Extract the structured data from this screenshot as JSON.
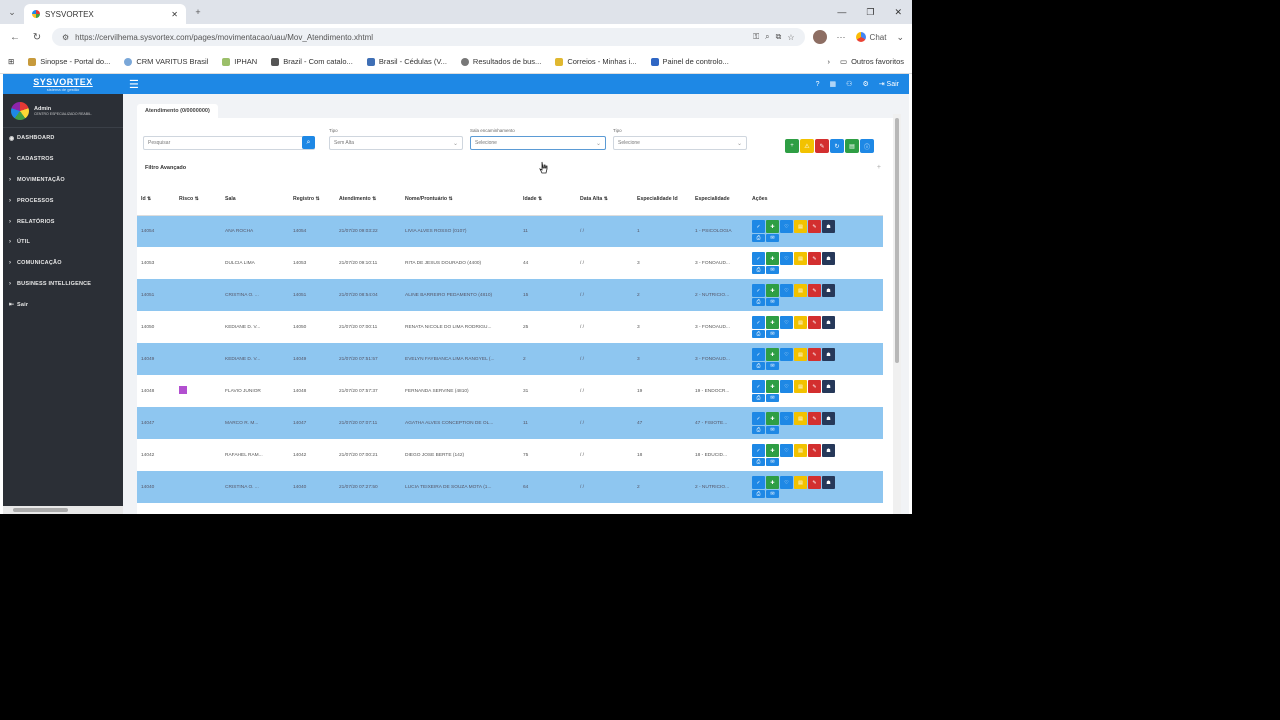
{
  "browser": {
    "tab_title": "SYSVORTEX",
    "new_tab": "+",
    "url": "https://cervilhema.sysvortex.com/pages/movimentacao/uau/Mov_Atendimento.xhtml",
    "chat_label": "Chat",
    "bookmarks": [
      "Sinopse - Portal do...",
      "CRM VARITUS Brasil",
      "IPHAN",
      "Brazil - Com catalo...",
      "Brasil - Cédulas (V...",
      "Resultados de bus...",
      "Correios - Minhas i...",
      "Painel de controlo..."
    ],
    "other_bookmarks": "Outros favoritos"
  },
  "app": {
    "logo": "SYSVORTEX",
    "logo_sub": "sistema de gestão",
    "user_name": "Admin",
    "user_org": "CENTRO ESPECIALIZADO REABIL.",
    "logout": "Sair",
    "menu": [
      {
        "icon": "◉",
        "label": "DASHBOARD"
      },
      {
        "icon": "›",
        "label": "CADASTROS"
      },
      {
        "icon": "›",
        "label": "MOVIMENTAÇÃO"
      },
      {
        "icon": "›",
        "label": "PROCESSOS"
      },
      {
        "icon": "›",
        "label": "RELATÓRIOS"
      },
      {
        "icon": "›",
        "label": "ÚTIL"
      },
      {
        "icon": "›",
        "label": "COMUNICAÇÃO"
      },
      {
        "icon": "›",
        "label": "BUSINESS INTELLIGENCE"
      },
      {
        "icon": "⇤",
        "label": "Sair"
      }
    ]
  },
  "page": {
    "tab_title": "Atendimento (0/0000000)",
    "search_placeholder": "Pesquisar",
    "filter_tipo_label": "Tipo",
    "filter_tipo_value": "Sem Alta",
    "filter_sala_label": "Sala encaminhamento",
    "filter_sala_value": "Selecione",
    "filter_tipo2_label": "Tipo",
    "filter_tipo2_value": "Selecione",
    "section_title": "Filtro Avançado",
    "section_plus": "+"
  },
  "table": {
    "headers": [
      "Id ⇅",
      "Risco ⇅",
      "Sala",
      "Registro ⇅",
      "Atendimento ⇅",
      "Nome/Prontuário ⇅",
      "Idade ⇅",
      "Data Alta ⇅",
      "Especialidade Id",
      "Especialidade",
      "Ações"
    ],
    "rows": [
      {
        "id": "14054",
        "risk": false,
        "sala": "ANA ROCHA",
        "reg": "14054",
        "at": "21/07/20 09:03:22",
        "nome": "LIVIA ALVES ROSSO (0107)",
        "idade": "11",
        "alta": "/ /",
        "espid": "1",
        "esp": "1 - PSICOLOGIA"
      },
      {
        "id": "14053",
        "risk": false,
        "sala": "DULCIA LIMA",
        "reg": "14053",
        "at": "21/07/20 09:10:11",
        "nome": "RITA DE JESUS DOURADO (4400)",
        "idade": "44",
        "alta": "/ /",
        "espid": "3",
        "esp": "3 - FONOAUD..."
      },
      {
        "id": "14051",
        "risk": false,
        "sala": "CRISTINA O. ...",
        "reg": "14051",
        "at": "21/07/20 08:54:04",
        "nome": "ALINE BARREIRO PEDAMENTO (4810)",
        "idade": "15",
        "alta": "/ /",
        "espid": "2",
        "esp": "2 - NUTRICIO..."
      },
      {
        "id": "14050",
        "risk": false,
        "sala": "KEDIANE D. V...",
        "reg": "14050",
        "at": "21/07/20 07:00:11",
        "nome": "RENATA NICOLE DO LIMA RODRIGU...",
        "idade": "25",
        "alta": "/ /",
        "espid": "3",
        "esp": "3 - FONOAUD..."
      },
      {
        "id": "14049",
        "risk": false,
        "sala": "KEDIANE D. V...",
        "reg": "14049",
        "at": "21/07/20 07:51:57",
        "nome": "EVELYN FAYBIANCA LIMA RANGYEL (...",
        "idade": "2",
        "alta": "/ /",
        "espid": "3",
        "esp": "3 - FONOAUD..."
      },
      {
        "id": "14048",
        "risk": true,
        "sala": "FLAVIO JUNIOR",
        "reg": "14048",
        "at": "21/07/20 07:57:37",
        "nome": "FERNANDA SERVINE (4810)",
        "idade": "31",
        "alta": "/ /",
        "espid": "19",
        "esp": "19 - ENDOCR..."
      },
      {
        "id": "14047",
        "risk": false,
        "sala": "MARCO R. M...",
        "reg": "14047",
        "at": "21/07/20 07:07:11",
        "nome": "AGATHA ALVES CONCEPTION DE OL...",
        "idade": "11",
        "alta": "/ /",
        "espid": "47",
        "esp": "47 - FISIOTE..."
      },
      {
        "id": "14042",
        "risk": false,
        "sala": "RAFAHEL RAM...",
        "reg": "14042",
        "at": "21/07/20 07:00:21",
        "nome": "DIEGO JOSE BERTE (142)",
        "idade": "75",
        "alta": "/ /",
        "espid": "18",
        "esp": "18 - EDUCID..."
      },
      {
        "id": "14040",
        "risk": false,
        "sala": "CRISTINA O. ...",
        "reg": "14040",
        "at": "21/07/20 07:27:50",
        "nome": "LUCIA TEIXEIRA DE SOUZA MOTA (1...",
        "idade": "64",
        "alta": "/ /",
        "espid": "2",
        "esp": "2 - NUTRICIO..."
      }
    ]
  },
  "colors": {
    "accent": "#1e88e5",
    "sidebar": "#2b2f36",
    "row_highlight": "#8ec6f0",
    "risk": "#b24fd0"
  }
}
